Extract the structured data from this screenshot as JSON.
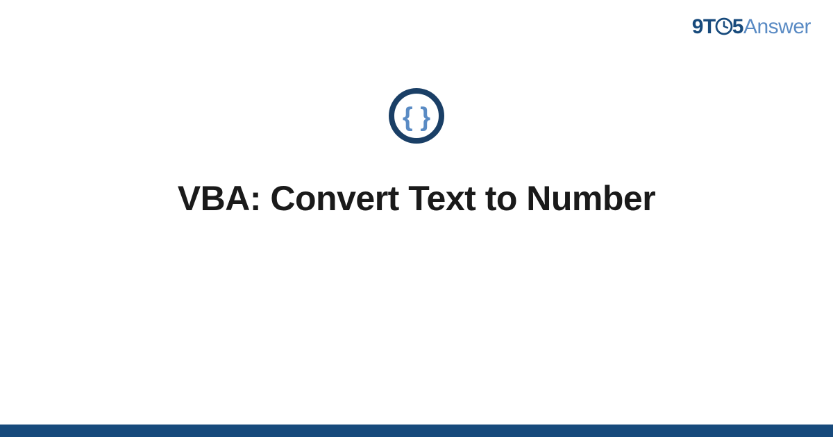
{
  "brand": {
    "part1": "9T",
    "part2": "5",
    "part3": "Answer"
  },
  "title": "VBA: Convert Text to Number",
  "colors": {
    "brand_dark": "#174a7c",
    "brand_light": "#5a8bc4",
    "badge_ring": "#1a3f66",
    "badge_braces": "#5a8bc4"
  }
}
